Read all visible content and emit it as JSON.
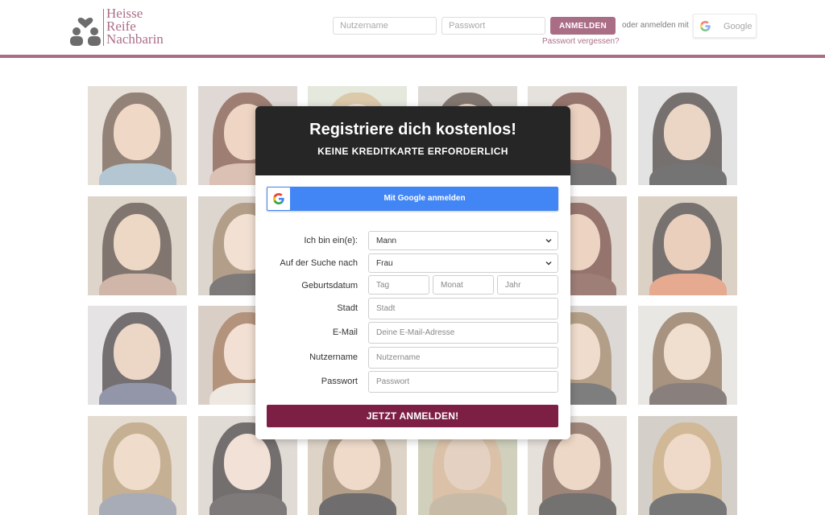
{
  "brand": {
    "logo_lines": [
      "Heisse",
      "Reife",
      "Nachbarin"
    ],
    "accent_color": "#7d1f45",
    "google_blue": "#4285f4"
  },
  "header": {
    "username_placeholder": "Nutzername",
    "password_placeholder": "Passwort",
    "login_label": "ANMELDEN",
    "or_login_with": "oder anmelden mit",
    "google_label": "Google",
    "forgot_password": "Passwort vergessen?"
  },
  "modal": {
    "title": "Registriere dich kostenlos!",
    "subtitle": "KEINE KREDITKARTE ERFORDERLICH",
    "google_signup": "Mit Google anmelden",
    "fields": {
      "gender_label": "Ich bin ein(e):",
      "gender_value": "Mann",
      "seeking_label": "Auf der Suche nach",
      "seeking_value": "Frau",
      "birthdate_label": "Geburtsdatum",
      "day_placeholder": "Tag",
      "month_placeholder": "Monat",
      "year_placeholder": "Jahr",
      "city_label": "Stadt",
      "city_placeholder": "Stadt",
      "email_label": "E-Mail",
      "email_placeholder": "Deine E-Mail-Adresse",
      "username_label": "Nutzername",
      "username_placeholder": "Nutzername",
      "password_label": "Passwort",
      "password_placeholder": "Passwort"
    },
    "submit_label": "JETZT ANMELDEN!"
  },
  "photo_grid": {
    "icon": "profile-photo",
    "tiles": [
      {
        "bg": "#d9cfc4",
        "hair": "#5a4030",
        "face": "#e8c4aa",
        "body": "#8aa8b8"
      },
      {
        "bg": "#cfc4bd",
        "hair": "#6b3a28",
        "face": "#e6bfa5",
        "body": "#c7a08a"
      },
      {
        "bg": "#d6dccb",
        "hair": "#c9ad7d",
        "face": "#ead2bb",
        "body": "#e6e2da"
      },
      {
        "bg": "#cdc7c0",
        "hair": "#3f2e24",
        "face": "#dfbba2",
        "body": "#3b3a3a"
      },
      {
        "bg": "#d8d2ca",
        "hair": "#5b2a20",
        "face": "#e2bba0",
        "body": "#2f2c2c"
      },
      {
        "bg": "#d5d5d5",
        "hair": "#2d2422",
        "face": "#e0c0a8",
        "body": "#2a2a2a"
      },
      {
        "bg": "#cdbfae",
        "hair": "#3d2b22",
        "face": "#e4c3a8",
        "body": "#b58f7a"
      },
      {
        "bg": "#c9c0b5",
        "hair": "#8a6a4a",
        "face": "#ecd0bc",
        "body": "#3a3434"
      },
      {
        "bg": "#d4cbc0",
        "hair": "#4a342a",
        "face": "#e6c6ae",
        "body": "#c9b6a8"
      },
      {
        "bg": "#d2cac2",
        "hair": "#4a2a20",
        "face": "#e0bba0",
        "body": "#7a5548"
      },
      {
        "bg": "#cbbfb4",
        "hair": "#5b2a20",
        "face": "#e3bea2",
        "body": "#6a3b2f"
      },
      {
        "bg": "#c8b8a6",
        "hair": "#2f2624",
        "face": "#dfb699",
        "body": "#d77d55"
      },
      {
        "bg": "#d8d4d6",
        "hair": "#2a2226",
        "face": "#e2c0a8",
        "body": "#5a5f7a"
      },
      {
        "bg": "#c7b5a8",
        "hair": "#8a5a36",
        "face": "#ead0bc",
        "body": "#e5dcd2"
      },
      {
        "bg": "#d7d1ca",
        "hair": "#3c2e28",
        "face": "#e2c4ad",
        "body": "#2f3438"
      },
      {
        "bg": "#cfc9c2",
        "hair": "#6a4a36",
        "face": "#e4c6b0",
        "body": "#5a504a"
      },
      {
        "bg": "#c9c4bf",
        "hair": "#8a6a48",
        "face": "#e6c9b2",
        "body": "#3a3a3a"
      },
      {
        "bg": "#dedad5",
        "hair": "#7a5a3c",
        "face": "#e8ccb6",
        "body": "#4a3c38"
      },
      {
        "bg": "#d6c9b8",
        "hair": "#a8865a",
        "face": "#e8c9ae",
        "body": "#7a8090"
      },
      {
        "bg": "#d2c8c0",
        "hair": "#2a2222",
        "face": "#ecd2c0",
        "body": "#3a3434"
      },
      {
        "bg": "#cbbdaa",
        "hair": "#8a6a4a",
        "face": "#e6c6ae",
        "body": "#232020"
      },
      {
        "bg": "#b7b79a",
        "hair": "#c6a07a",
        "face": "#d6b8a0",
        "body": "#a9977a"
      },
      {
        "bg": "#d8cfc6",
        "hair": "#6a4432",
        "face": "#e4c2a8",
        "body": "#2a2626"
      },
      {
        "bg": "#bfb6ad",
        "hair": "#b8925e",
        "face": "#e6c6ae",
        "body": "#2e2e30"
      }
    ]
  }
}
